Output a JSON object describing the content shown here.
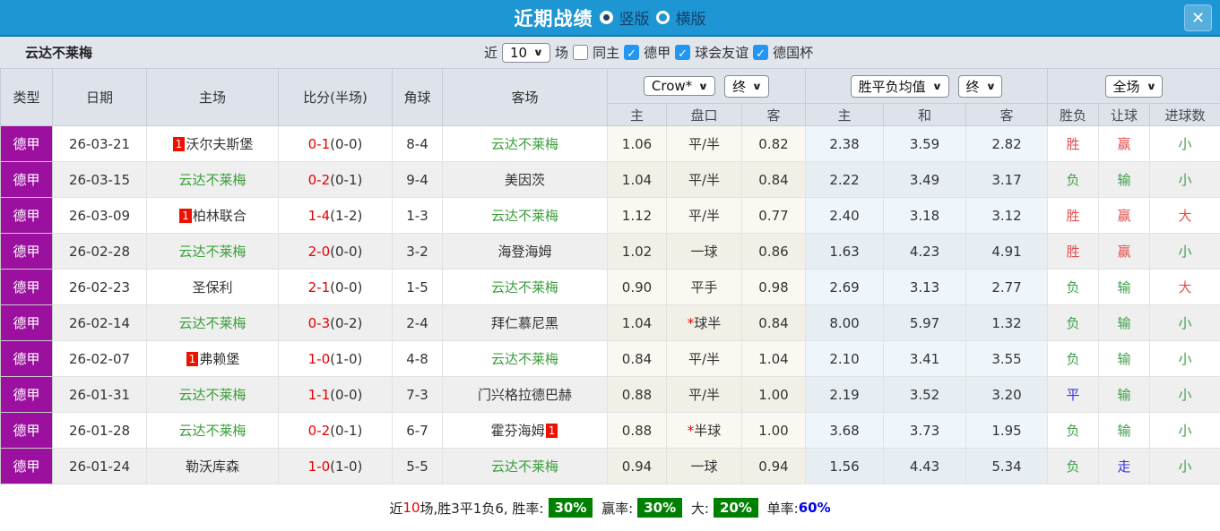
{
  "colors": {
    "titlebar_blue": "#1e96d3",
    "league_purple": "#9b109e",
    "self_team_green": "#3a9e3a",
    "score_red": "#e60000",
    "result_red": "#e14f4f",
    "result_green": "#3fa04a",
    "result_blue": "#3535e8",
    "badge_green": "#008000",
    "checkbox_blue": "#2196f3"
  },
  "titlebar": {
    "title": "近期战绩",
    "vertical_label": "竖版",
    "horizontal_label": "横版",
    "close_label": "✕"
  },
  "filterbar": {
    "team": "云达不莱梅",
    "recent_label": "近",
    "recent_value": "10",
    "matches_label": "场",
    "same_home_label": "同主",
    "filters": [
      "德甲",
      "球会友谊",
      "德国杯"
    ]
  },
  "table": {
    "headers": [
      "类型",
      "日期",
      "主场",
      "比分(半场)",
      "角球",
      "客场"
    ],
    "controls": {
      "company": "Crow*",
      "company_time": "终",
      "avg": "胜平负均值",
      "avg_time": "终",
      "scope": "全场"
    },
    "sub_headers": [
      "主",
      "盘口",
      "客",
      "主",
      "和",
      "客",
      "胜负",
      "让球",
      "进球数"
    ],
    "rows": [
      {
        "league": "德甲",
        "date": "26-03-21",
        "home_badge": "1",
        "home": "沃尔夫斯堡",
        "home_color": "",
        "score": "0-1",
        "half": "(0-0)",
        "corner": "8-4",
        "away_badge": "",
        "away": "云达不莱梅",
        "away_color": "self",
        "crow_home": "1.06",
        "star": "",
        "handicap": "平/半",
        "crow_away": "0.82",
        "avg_home": "2.38",
        "avg_draw": "3.59",
        "avg_away": "2.82",
        "result": "胜",
        "result_color": "red",
        "spread": "赢",
        "spread_color": "red",
        "goal": "小",
        "goal_color": "green"
      },
      {
        "league": "德甲",
        "date": "26-03-15",
        "home_badge": "",
        "home": "云达不莱梅",
        "home_color": "self",
        "score": "0-2",
        "half": "(0-1)",
        "corner": "9-4",
        "away_badge": "",
        "away": "美因茨",
        "away_color": "",
        "crow_home": "1.04",
        "star": "",
        "handicap": "平/半",
        "crow_away": "0.84",
        "avg_home": "2.22",
        "avg_draw": "3.49",
        "avg_away": "3.17",
        "result": "负",
        "result_color": "green",
        "spread": "输",
        "spread_color": "green",
        "goal": "小",
        "goal_color": "green"
      },
      {
        "league": "德甲",
        "date": "26-03-09",
        "home_badge": "1",
        "home": "柏林联合",
        "home_color": "",
        "score": "1-4",
        "half": "(1-2)",
        "corner": "1-3",
        "away_badge": "",
        "away": "云达不莱梅",
        "away_color": "self",
        "crow_home": "1.12",
        "star": "",
        "handicap": "平/半",
        "crow_away": "0.77",
        "avg_home": "2.40",
        "avg_draw": "3.18",
        "avg_away": "3.12",
        "result": "胜",
        "result_color": "red",
        "spread": "赢",
        "spread_color": "red",
        "goal": "大",
        "goal_color": "red"
      },
      {
        "league": "德甲",
        "date": "26-02-28",
        "home_badge": "",
        "home": "云达不莱梅",
        "home_color": "self",
        "score": "2-0",
        "half": "(0-0)",
        "corner": "3-2",
        "away_badge": "",
        "away": "海登海姆",
        "away_color": "",
        "crow_home": "1.02",
        "star": "",
        "handicap": "一球",
        "crow_away": "0.86",
        "avg_home": "1.63",
        "avg_draw": "4.23",
        "avg_away": "4.91",
        "result": "胜",
        "result_color": "red",
        "spread": "赢",
        "spread_color": "red",
        "goal": "小",
        "goal_color": "green"
      },
      {
        "league": "德甲",
        "date": "26-02-23",
        "home_badge": "",
        "home": "圣保利",
        "home_color": "",
        "score": "2-1",
        "half": "(0-0)",
        "corner": "1-5",
        "away_badge": "",
        "away": "云达不莱梅",
        "away_color": "self",
        "crow_home": "0.90",
        "star": "",
        "handicap": "平手",
        "crow_away": "0.98",
        "avg_home": "2.69",
        "avg_draw": "3.13",
        "avg_away": "2.77",
        "result": "负",
        "result_color": "green",
        "spread": "输",
        "spread_color": "green",
        "goal": "大",
        "goal_color": "red"
      },
      {
        "league": "德甲",
        "date": "26-02-14",
        "home_badge": "",
        "home": "云达不莱梅",
        "home_color": "self",
        "score": "0-3",
        "half": "(0-2)",
        "corner": "2-4",
        "away_badge": "",
        "away": "拜仁慕尼黑",
        "away_color": "",
        "crow_home": "1.04",
        "star": "*",
        "handicap": "球半",
        "crow_away": "0.84",
        "avg_home": "8.00",
        "avg_draw": "5.97",
        "avg_away": "1.32",
        "result": "负",
        "result_color": "green",
        "spread": "输",
        "spread_color": "green",
        "goal": "小",
        "goal_color": "green"
      },
      {
        "league": "德甲",
        "date": "26-02-07",
        "home_badge": "1",
        "home": "弗赖堡",
        "home_color": "",
        "score": "1-0",
        "half": "(1-0)",
        "corner": "4-8",
        "away_badge": "",
        "away": "云达不莱梅",
        "away_color": "self",
        "crow_home": "0.84",
        "star": "",
        "handicap": "平/半",
        "crow_away": "1.04",
        "avg_home": "2.10",
        "avg_draw": "3.41",
        "avg_away": "3.55",
        "result": "负",
        "result_color": "green",
        "spread": "输",
        "spread_color": "green",
        "goal": "小",
        "goal_color": "green"
      },
      {
        "league": "德甲",
        "date": "26-01-31",
        "home_badge": "",
        "home": "云达不莱梅",
        "home_color": "self",
        "score": "1-1",
        "half": "(0-0)",
        "corner": "7-3",
        "away_badge": "",
        "away": "门兴格拉德巴赫",
        "away_color": "",
        "crow_home": "0.88",
        "star": "",
        "handicap": "平/半",
        "crow_away": "1.00",
        "avg_home": "2.19",
        "avg_draw": "3.52",
        "avg_away": "3.20",
        "result": "平",
        "result_color": "blue",
        "spread": "输",
        "spread_color": "green",
        "goal": "小",
        "goal_color": "green"
      },
      {
        "league": "德甲",
        "date": "26-01-28",
        "home_badge": "",
        "home": "云达不莱梅",
        "home_color": "self",
        "score": "0-2",
        "half": "(0-1)",
        "corner": "6-7",
        "away_badge": "1",
        "away": "霍芬海姆",
        "away_color": "",
        "crow_home": "0.88",
        "star": "*",
        "handicap": "半球",
        "crow_away": "1.00",
        "avg_home": "3.68",
        "avg_draw": "3.73",
        "avg_away": "1.95",
        "result": "负",
        "result_color": "green",
        "spread": "输",
        "spread_color": "green",
        "goal": "小",
        "goal_color": "green"
      },
      {
        "league": "德甲",
        "date": "26-01-24",
        "home_badge": "",
        "home": "勒沃库森",
        "home_color": "",
        "score": "1-0",
        "half": "(1-0)",
        "corner": "5-5",
        "away_badge": "",
        "away": "云达不莱梅",
        "away_color": "self",
        "crow_home": "0.94",
        "star": "",
        "handicap": "一球",
        "crow_away": "0.94",
        "avg_home": "1.56",
        "avg_draw": "4.43",
        "avg_away": "5.34",
        "result": "负",
        "result_color": "green",
        "spread": "走",
        "spread_color": "blue",
        "goal": "小",
        "goal_color": "green"
      }
    ]
  },
  "footer": {
    "t1": "近",
    "t2": "10",
    "t3": "场,胜3平1负6, 胜率:",
    "b1": "30%",
    "t4": " 赢率:",
    "b2": "30%",
    "t5": " 大:",
    "b3": "20%",
    "t6": " 单率:",
    "b4": "60%"
  }
}
